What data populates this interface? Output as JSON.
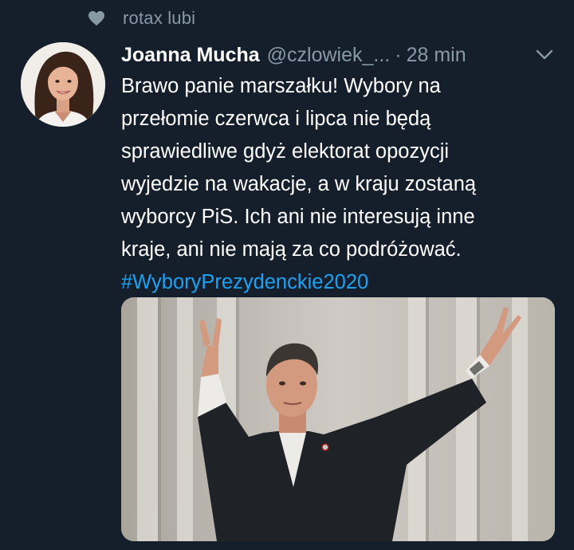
{
  "social_context": {
    "icon": "heart-icon",
    "text": "rotax lubi"
  },
  "tweet": {
    "display_name": "Joanna Mucha",
    "handle": "@czlowiek_...",
    "separator": "·",
    "time": "28 min",
    "text_lines": [
      "Brawo panie marszałku! Wybory na",
      "przełomie czerwca i lipca  nie będą",
      "sprawiedliwe gdyż elektorat opozycji",
      "wyjedzie na wakacje, a w kraju zostaną",
      "wyborcy PiS. Ich ani nie interesują inne",
      "kraje, ani nie mają za co podróżować."
    ],
    "hashtag": "#WyboryPrezydenckie2020"
  },
  "colors": {
    "background": "#151f2b",
    "secondary_text": "#8899a6",
    "link": "#1da1f2"
  }
}
